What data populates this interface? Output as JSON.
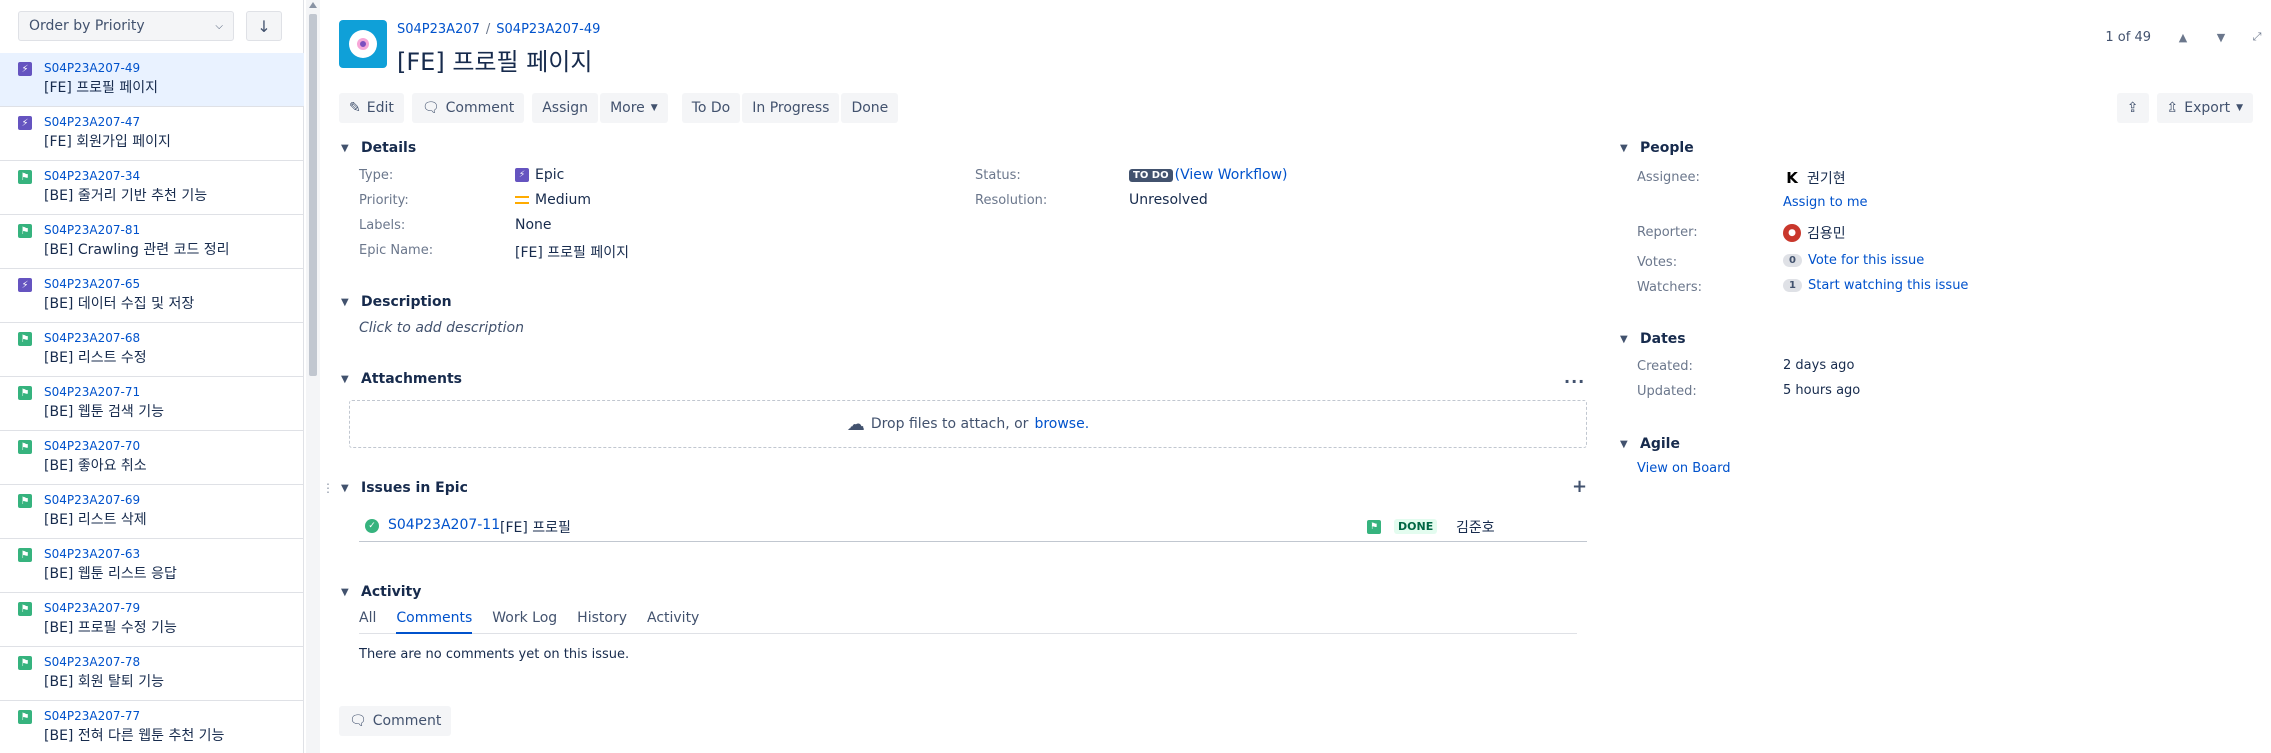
{
  "sidebar": {
    "order_select": "Order by Priority",
    "order_dir_icon": "arrow-down-icon",
    "items": [
      {
        "key": "S04P23A207-49",
        "summary": "[FE] 프로필 페이지",
        "type": "epic",
        "active": true
      },
      {
        "key": "S04P23A207-47",
        "summary": "[FE] 회원가입 페이지",
        "type": "epic"
      },
      {
        "key": "S04P23A207-34",
        "summary": "[BE] 줄거리 기반 추천 기능",
        "type": "story"
      },
      {
        "key": "S04P23A207-81",
        "summary": "[BE] Crawling 관련 코드 정리",
        "type": "story"
      },
      {
        "key": "S04P23A207-65",
        "summary": "[BE] 데이터 수집 및 저장",
        "type": "epic"
      },
      {
        "key": "S04P23A207-68",
        "summary": "[BE] 리스트 수정",
        "type": "story"
      },
      {
        "key": "S04P23A207-71",
        "summary": "[BE] 웹툰 검색 기능",
        "type": "story"
      },
      {
        "key": "S04P23A207-70",
        "summary": "[BE] 좋아요 취소",
        "type": "story"
      },
      {
        "key": "S04P23A207-69",
        "summary": "[BE] 리스트 삭제",
        "type": "story"
      },
      {
        "key": "S04P23A207-63",
        "summary": "[BE] 웹툰 리스트 응답",
        "type": "story"
      },
      {
        "key": "S04P23A207-79",
        "summary": "[BE] 프로필 수정 기능",
        "type": "story"
      },
      {
        "key": "S04P23A207-78",
        "summary": "[BE] 회원 탈퇴 기능",
        "type": "story"
      },
      {
        "key": "S04P23A207-77",
        "summary": "[BE] 전혀 다른 웹툰 추천 기능",
        "type": "story"
      }
    ]
  },
  "header": {
    "project_key": "S04P23A207",
    "issue_key": "S04P23A207-49",
    "title": "[FE] 프로필 페이지",
    "pager": "1 of 49"
  },
  "toolbar": {
    "edit": "Edit",
    "comment": "Comment",
    "assign": "Assign",
    "more": "More",
    "todo": "To Do",
    "in_progress": "In Progress",
    "done": "Done",
    "export": "Export"
  },
  "details": {
    "heading": "Details",
    "type_label": "Type:",
    "type_value": "Epic",
    "priority_label": "Priority:",
    "priority_value": "Medium",
    "labels_label": "Labels:",
    "labels_value": "None",
    "epic_name_label": "Epic Name:",
    "epic_name_value": "[FE] 프로필 페이지",
    "status_label": "Status:",
    "status_badge": "TO DO",
    "status_link": "(View Workflow)",
    "resolution_label": "Resolution:",
    "resolution_value": "Unresolved"
  },
  "description": {
    "heading": "Description",
    "placeholder": "Click to add description"
  },
  "attachments": {
    "heading": "Attachments",
    "drop_text": "Drop files to attach, or",
    "browse": "browse."
  },
  "issues_in_epic": {
    "heading": "Issues in Epic",
    "rows": [
      {
        "key": "S04P23A207-11",
        "summary": "[FE] 프로필",
        "status": "DONE",
        "assignee": "김준호"
      }
    ]
  },
  "activity": {
    "heading": "Activity",
    "tabs": [
      "All",
      "Comments",
      "Work Log",
      "History",
      "Activity"
    ],
    "active_tab": "Comments",
    "empty": "There are no comments yet on this issue.",
    "comment_button": "Comment"
  },
  "people": {
    "heading": "People",
    "assignee_label": "Assignee:",
    "assignee": "권기현",
    "assignee_avatar": "K",
    "assign_to_me": "Assign to me",
    "reporter_label": "Reporter:",
    "reporter": "김용민",
    "votes_label": "Votes:",
    "votes": "0",
    "vote_link": "Vote for this issue",
    "watchers_label": "Watchers:",
    "watchers": "1",
    "watch_link": "Start watching this issue"
  },
  "dates": {
    "heading": "Dates",
    "created_label": "Created:",
    "created": "2 days ago",
    "updated_label": "Updated:",
    "updated": "5 hours ago"
  },
  "agile": {
    "heading": "Agile",
    "board_link": "View on Board"
  },
  "colors": {
    "link": "#0052cc",
    "epic": "#6554c0",
    "story": "#36b37e",
    "active_row": "#e9f2ff"
  }
}
